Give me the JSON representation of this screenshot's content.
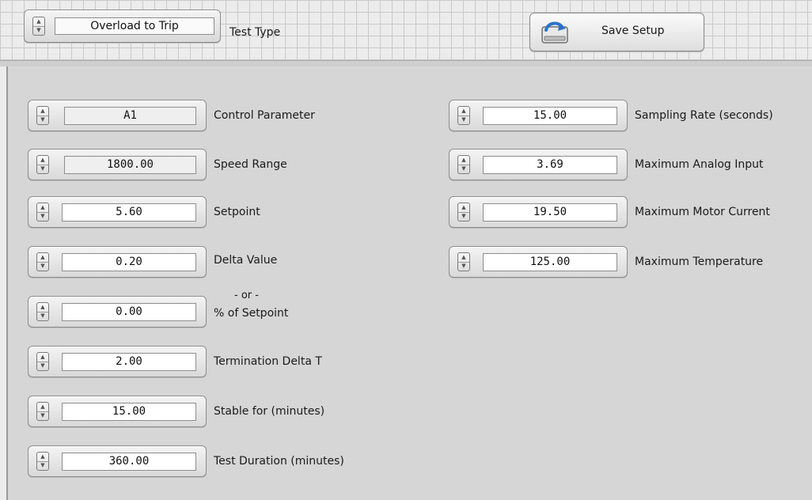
{
  "header": {
    "test_type_value": "Overload to Trip",
    "test_type_label": "Test Type",
    "save_button_label": "Save Setup"
  },
  "left_controls": [
    {
      "value": "A1",
      "label": "Control Parameter"
    },
    {
      "value": "1800.00",
      "label": "Speed Range"
    },
    {
      "value": "5.60",
      "label": "Setpoint"
    },
    {
      "value": "0.20",
      "label": "Delta Value"
    },
    {
      "value": "0.00",
      "label": "% of Setpoint"
    },
    {
      "value": "2.00",
      "label": "Termination Delta T"
    },
    {
      "value": "15.00",
      "label": "Stable for (minutes)"
    },
    {
      "value": "360.00",
      "label": "Test Duration (minutes)"
    }
  ],
  "or_separator": "- or -",
  "right_controls": [
    {
      "value": "15.00",
      "label": "Sampling Rate (seconds)"
    },
    {
      "value": "3.69",
      "label": "Maximum Analog Input"
    },
    {
      "value": "19.50",
      "label": "Maximum Motor Current"
    },
    {
      "value": "125.00",
      "label": "Maximum Temperature"
    }
  ],
  "icons": {
    "spinner": "up-down-arrows-icon",
    "save": "save-disk-arrow-icon"
  }
}
